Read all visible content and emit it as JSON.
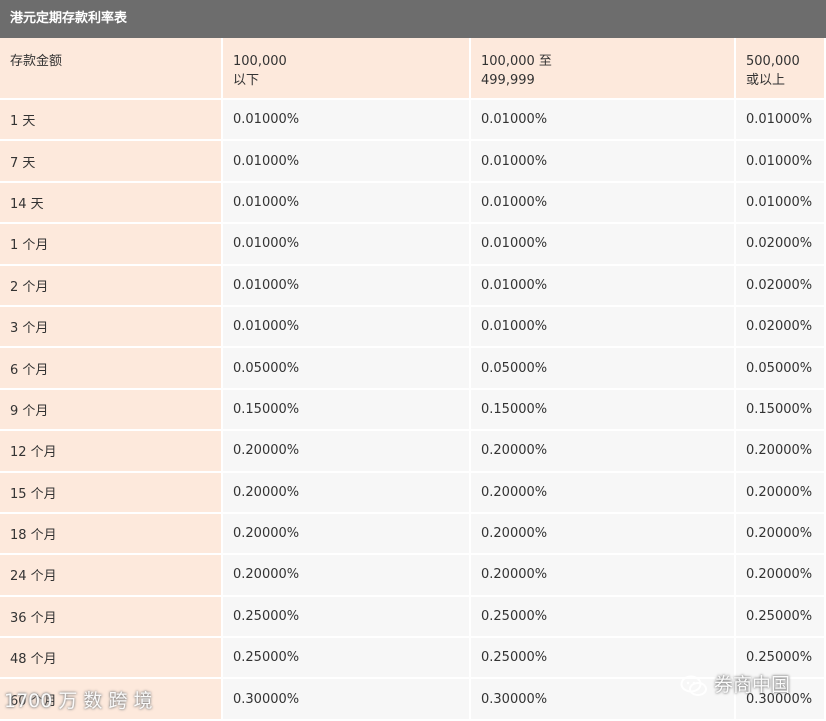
{
  "title": "港元定期存款利率表",
  "header": {
    "col0": "存款金额",
    "col1_line1": "100,000",
    "col1_line2": "以下",
    "col2_line1": "100,000 至",
    "col2_line2": "499,999",
    "col3_line1": "500,000",
    "col3_line2": "或以上"
  },
  "rows": [
    {
      "term": "1 天",
      "r1": "0.01000%",
      "r2": "0.01000%",
      "r3": "0.01000%"
    },
    {
      "term": "7 天",
      "r1": "0.01000%",
      "r2": "0.01000%",
      "r3": "0.01000%"
    },
    {
      "term": "14 天",
      "r1": "0.01000%",
      "r2": "0.01000%",
      "r3": "0.01000%"
    },
    {
      "term": "1 个月",
      "r1": "0.01000%",
      "r2": "0.01000%",
      "r3": "0.02000%"
    },
    {
      "term": "2 个月",
      "r1": "0.01000%",
      "r2": "0.01000%",
      "r3": "0.02000%"
    },
    {
      "term": "3 个月",
      "r1": "0.01000%",
      "r2": "0.01000%",
      "r3": "0.02000%"
    },
    {
      "term": "6 个月",
      "r1": "0.05000%",
      "r2": "0.05000%",
      "r3": "0.05000%"
    },
    {
      "term": "9 个月",
      "r1": "0.15000%",
      "r2": "0.15000%",
      "r3": "0.15000%"
    },
    {
      "term": "12 个月",
      "r1": "0.20000%",
      "r2": "0.20000%",
      "r3": "0.20000%"
    },
    {
      "term": "15 个月",
      "r1": "0.20000%",
      "r2": "0.20000%",
      "r3": "0.20000%"
    },
    {
      "term": "18 个月",
      "r1": "0.20000%",
      "r2": "0.20000%",
      "r3": "0.20000%"
    },
    {
      "term": "24 个月",
      "r1": "0.20000%",
      "r2": "0.20000%",
      "r3": "0.20000%"
    },
    {
      "term": "36 个月",
      "r1": "0.25000%",
      "r2": "0.25000%",
      "r3": "0.25000%"
    },
    {
      "term": "48 个月",
      "r1": "0.25000%",
      "r2": "0.25000%",
      "r3": "0.25000%"
    },
    {
      "term": "60 个月",
      "r1": "0.30000%",
      "r2": "0.30000%",
      "r3": "0.30000%"
    }
  ],
  "watermark_left": "1700 万 数 跨 境",
  "watermark_right": "券商中国",
  "icons": {
    "watermark_right": "wechat-icon"
  },
  "colors": {
    "title_bg": "#6d6d6d",
    "label_bg": "#fde9dc",
    "value_bg": "#f7f7f7"
  }
}
